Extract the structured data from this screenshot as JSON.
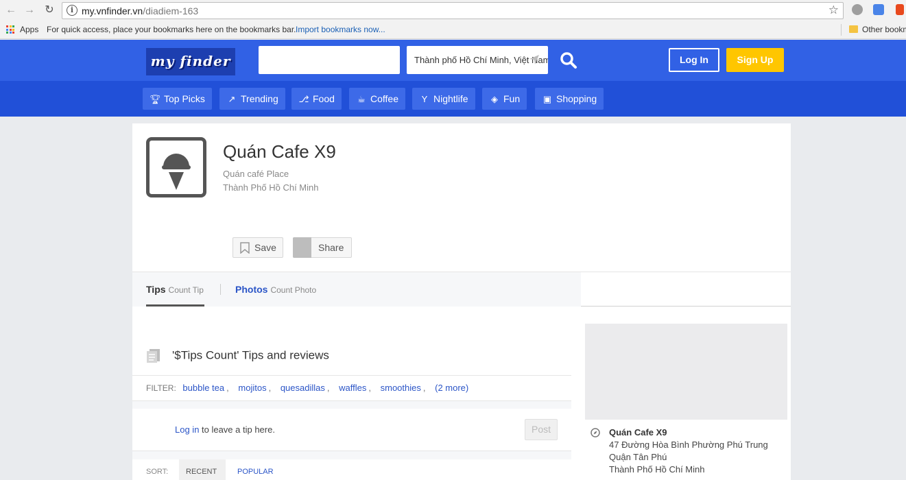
{
  "browser": {
    "url_host": "my.vnfinder.vn",
    "url_path": "/diadiem-163",
    "apps_label": "Apps",
    "bookmarks_hint": "For quick access, place your bookmarks here on the bookmarks bar.",
    "import_link": "Import bookmarks now...",
    "other_bookmarks": "Other bookm"
  },
  "header": {
    "logo_text": "my finder",
    "search_placeholder": "",
    "location_value": "Thành phố Hồ Chí Minh, Việt Nam",
    "login_label": "Log In",
    "signup_label": "Sign Up",
    "accent_color": "#3161e5",
    "signup_color": "#ffc600"
  },
  "categories": [
    {
      "label": "Top Picks",
      "icon": "trophy-icon"
    },
    {
      "label": "Trending",
      "icon": "trending-icon"
    },
    {
      "label": "Food",
      "icon": "fork-knife-icon"
    },
    {
      "label": "Coffee",
      "icon": "coffee-cup-icon"
    },
    {
      "label": "Nightlife",
      "icon": "cocktail-icon"
    },
    {
      "label": "Fun",
      "icon": "ticket-icon"
    },
    {
      "label": "Shopping",
      "icon": "shopping-bag-icon"
    }
  ],
  "place": {
    "title": "Quán Cafe X9",
    "type": "Quán café Place",
    "city": "Thành Phố Hồ Chí Minh",
    "save_label": "Save",
    "share_label": "Share"
  },
  "tabs": {
    "tips_label": "Tips",
    "tips_count": "Count Tip",
    "photos_label": "Photos",
    "photos_count": "Count Photo"
  },
  "tips": {
    "heading": "'$Tips Count' Tips and reviews",
    "filter_label": "FILTER:",
    "filters": [
      "bubble tea",
      "mojitos",
      "quesadillas",
      "waffles",
      "smoothies"
    ],
    "more_label": "(2 more)",
    "login_link": "Log in",
    "login_rest": "to leave a tip here.",
    "post_label": "Post",
    "sort_label": "SORT:",
    "sort_recent": "RECENT",
    "sort_popular": "POPULAR"
  },
  "sidebar": {
    "name": "Quán Cafe X9",
    "address_line1": "47 Đường Hòa Bình Phường Phú Trung",
    "address_line2": "Quận Tân Phú",
    "address_line3": "Thành Phố Hồ Chí Minh"
  }
}
